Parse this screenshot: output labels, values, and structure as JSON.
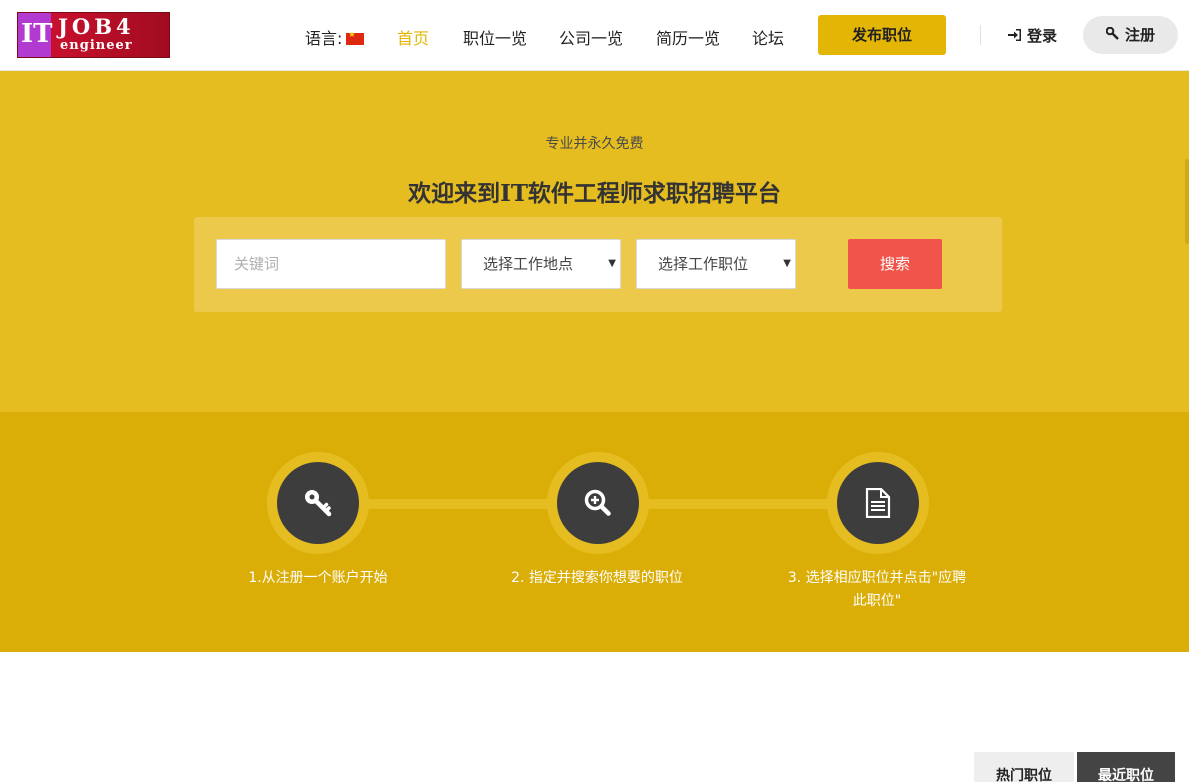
{
  "logo": {
    "it": "IT",
    "job": "JOB4",
    "engineer": "engineer"
  },
  "nav": {
    "language_label": "语言:",
    "home": "首页",
    "jobs": "职位一览",
    "companies": "公司一览",
    "resumes": "简历一览",
    "forum": "论坛",
    "post_job": "发布职位",
    "login": "登录",
    "register": "注册"
  },
  "hero": {
    "subtitle": "专业并永久免费",
    "title": "欢迎来到IT软件工程师求职招聘平台",
    "search": {
      "keyword_placeholder": "关键词",
      "location_select": "选择工作地点",
      "position_select": "选择工作职位",
      "button": "搜索"
    }
  },
  "steps": {
    "items": [
      {
        "icon": "key-icon",
        "label": "1.从注册一个账户开始"
      },
      {
        "icon": "zoom-in-icon",
        "label": "2. 指定并搜索你想要的职位"
      },
      {
        "icon": "document-icon",
        "label": "3. 选择相应职位并点击\"应聘此职位\""
      }
    ]
  },
  "tabs": {
    "hot": "热门职位",
    "recent": "最近职位"
  },
  "colors": {
    "accent": "#e3b505",
    "hero_bg": "#e6bd20",
    "steps_bg": "#dbae07",
    "search_button": "#f0544a",
    "icon_circle": "#3d3d3d"
  }
}
